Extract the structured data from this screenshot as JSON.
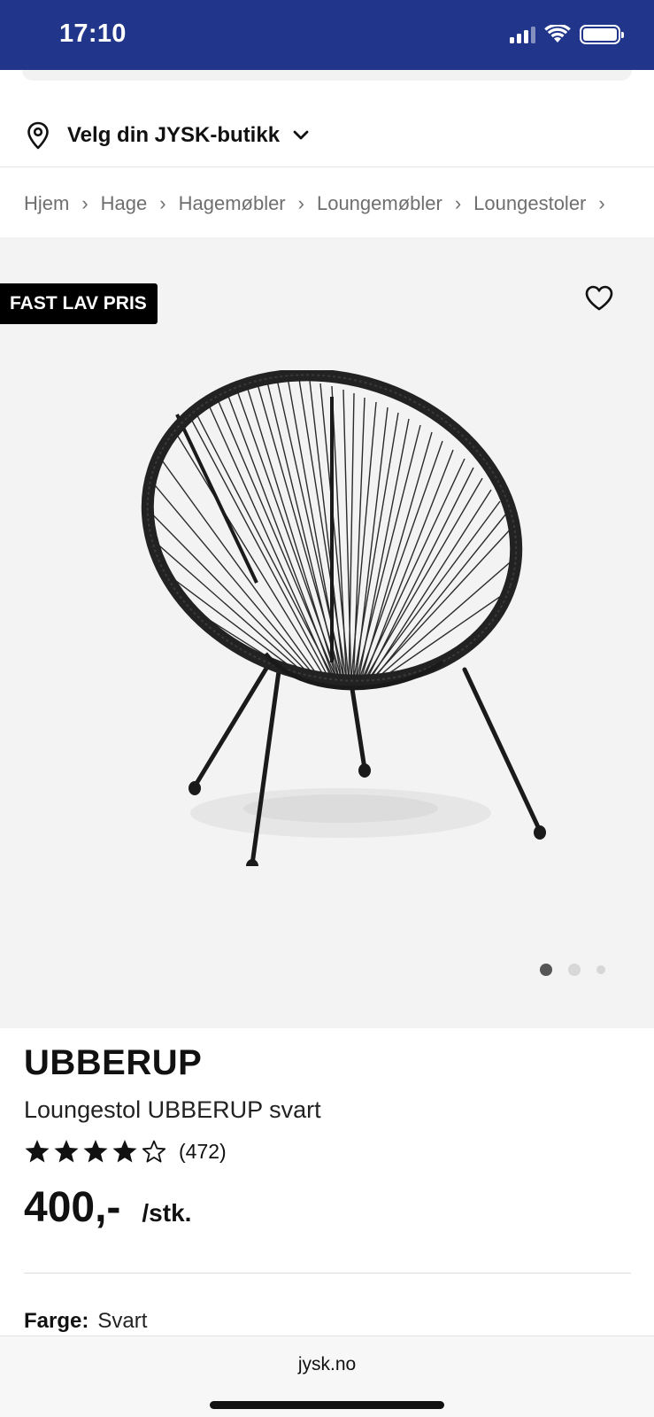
{
  "status_bar": {
    "time": "17:10",
    "icons": [
      "signal-icon",
      "wifi-icon",
      "battery-icon"
    ]
  },
  "store": {
    "label": "Velg din JYSK-butikk",
    "icon": "location-pin-icon"
  },
  "breadcrumb": [
    "Hjem",
    "Hage",
    "Hagemøbler",
    "Loungemøbler",
    "Loungestoler"
  ],
  "gallery": {
    "badge": "FAST LAV PRIS",
    "image_count": 3,
    "active_image": 1
  },
  "product": {
    "brand": "UBBERUP",
    "name": "Loungestol UBBERUP svart",
    "rating": 4,
    "rating_max": 5,
    "review_count": "(472)",
    "price": "400,-",
    "unit": "/stk.",
    "color_label": "Farge:",
    "color_value": "Svart"
  },
  "browser": {
    "url": "jysk.no"
  },
  "colors": {
    "status_bar": "#21368b",
    "badge": "#000000",
    "gallery_bg": "#f3f3f3"
  }
}
